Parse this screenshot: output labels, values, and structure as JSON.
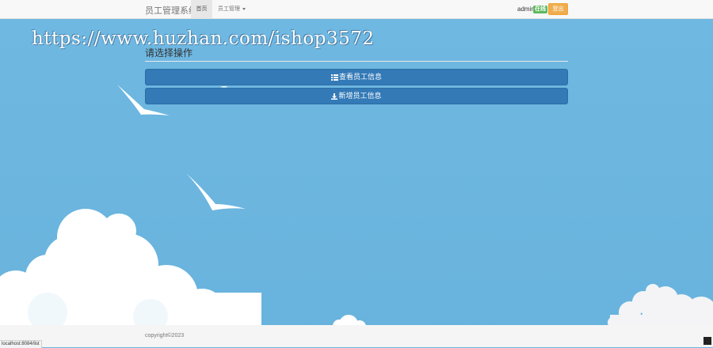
{
  "navbar": {
    "brand": "员工管理系统",
    "home": "首页",
    "menu": "员工管理",
    "username": "admin",
    "status_badge": "在线",
    "logout": "登出"
  },
  "watermark": "https://www.huzhan.com/ishop3572",
  "main": {
    "prompt": "请选择操作",
    "actions": [
      {
        "label": "查看员工信息",
        "icon": "list-icon"
      },
      {
        "label": "新增员工信息",
        "icon": "download-icon"
      }
    ]
  },
  "footer": {
    "copyright": "copyright©2023"
  },
  "statusbar": {
    "url": "localhost:8084/list"
  },
  "colors": {
    "sky": "#6cb6e0",
    "primary": "#337ab7",
    "success": "#5cb85c",
    "warning": "#f0ad4e"
  }
}
